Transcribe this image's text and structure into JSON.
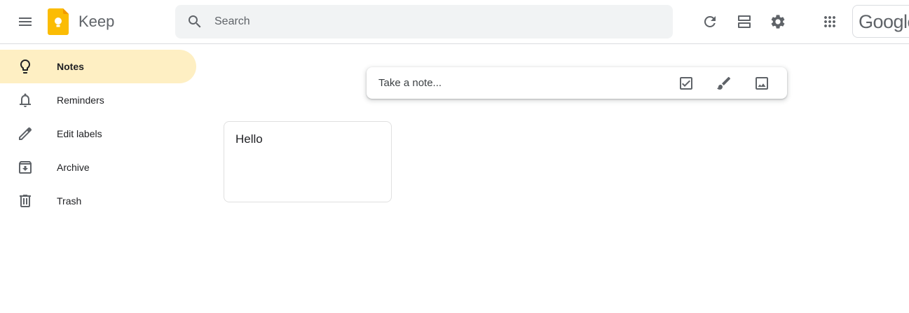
{
  "header": {
    "app_title": "Keep",
    "search": {
      "placeholder": "Search",
      "value": ""
    },
    "account_label": "Google"
  },
  "sidebar": {
    "items": [
      {
        "label": "Notes",
        "icon": "lightbulb-icon",
        "active": true
      },
      {
        "label": "Reminders",
        "icon": "bell-icon",
        "active": false
      },
      {
        "label": "Edit labels",
        "icon": "pencil-icon",
        "active": false
      },
      {
        "label": "Archive",
        "icon": "archive-icon",
        "active": false
      },
      {
        "label": "Trash",
        "icon": "trash-icon",
        "active": false
      }
    ]
  },
  "composer": {
    "placeholder": "Take a note..."
  },
  "notes": [
    {
      "title": "Hello"
    }
  ],
  "colors": {
    "accent": "#fbbc04",
    "active_nav": "#feefc3",
    "search_bg": "#f1f3f4",
    "icon": "#5f6368"
  }
}
